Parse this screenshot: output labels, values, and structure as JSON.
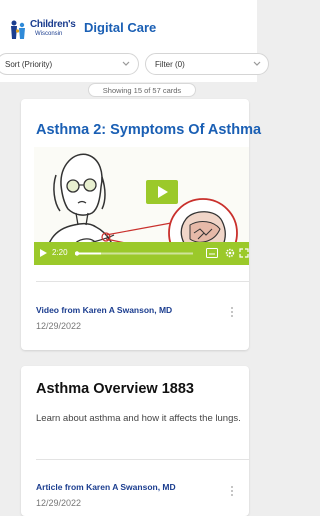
{
  "header": {
    "logo_name": "Children's",
    "logo_sub": "Wisconsin",
    "app_title": "Digital Care"
  },
  "controls": {
    "sort_label": "Sort (Priority)",
    "filter_label": "Filter (0)"
  },
  "count_text": "Showing 15 of 57 cards",
  "cards": [
    {
      "title": "Asthma 2: Symptoms Of Asthma",
      "video_time": "2:20",
      "author": "Video from Karen A Swanson, MD",
      "date": "12/29/2022"
    },
    {
      "title": "Asthma Overview 1883",
      "description": "Learn about asthma and how it affects the lungs.",
      "author": "Article from Karen A Swanson, MD",
      "date": "12/29/2022"
    }
  ],
  "colors": {
    "brand_blue": "#1a5fb4",
    "video_green": "#9bc92a"
  }
}
